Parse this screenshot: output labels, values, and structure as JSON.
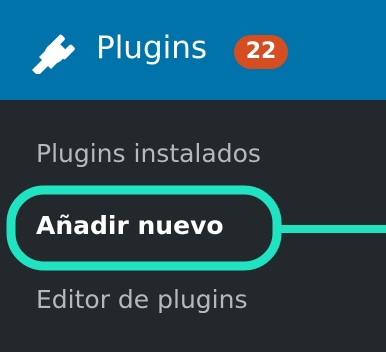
{
  "menu": {
    "header": {
      "icon": "plugin-plug-icon",
      "label": "Plugins",
      "update_count": "22"
    },
    "items": [
      {
        "label": "Plugins instalados",
        "current": false
      },
      {
        "label": "Añadir nuevo",
        "current": true
      },
      {
        "label": "Editor de plugins",
        "current": false
      }
    ]
  },
  "colors": {
    "header_background": "#0073aa",
    "submenu_background": "#23282d",
    "badge_background": "#d54e21",
    "highlight_outline": "#20e3c2",
    "text_inactive": "#b4b9be",
    "text_current": "#ffffff"
  }
}
